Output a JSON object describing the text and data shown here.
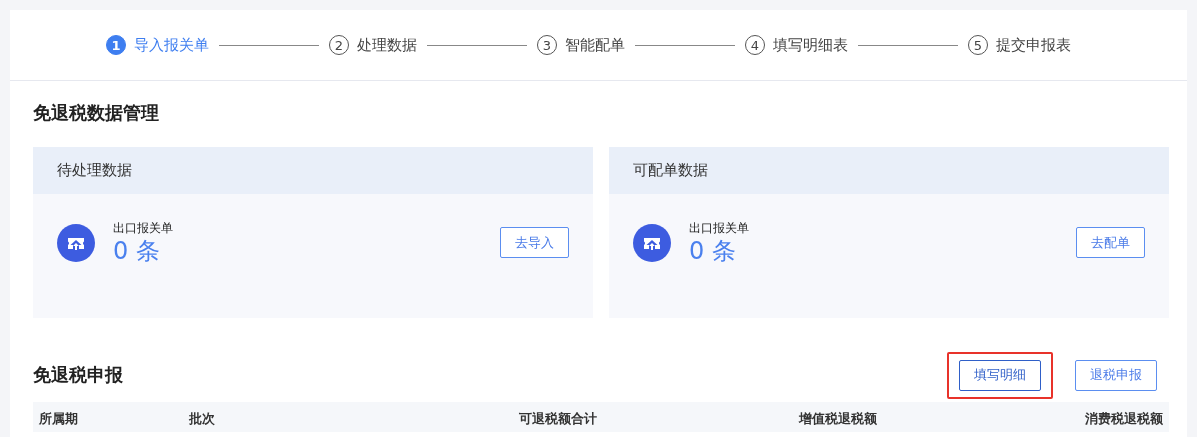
{
  "steps": [
    {
      "number": "1",
      "label": "导入报关单",
      "selected": true
    },
    {
      "number": "2",
      "label": "处理数据",
      "selected": false
    },
    {
      "number": "3",
      "label": "智能配单",
      "selected": false
    },
    {
      "number": "4",
      "label": "填写明细表",
      "selected": false
    },
    {
      "number": "5",
      "label": "提交申报表",
      "selected": false
    }
  ],
  "data_section": {
    "title": "免退税数据管理",
    "cards": [
      {
        "title": "待处理数据",
        "item_label": "出口报关单",
        "count": "0 条",
        "button": "去导入"
      },
      {
        "title": "可配单数据",
        "item_label": "出口报关单",
        "count": "0 条",
        "button": "去配单"
      }
    ]
  },
  "declaration_section": {
    "title": "免退税申报",
    "buttons": [
      {
        "label": "填写明细",
        "highlighted": true
      },
      {
        "label": "退税申报",
        "highlighted": false
      }
    ],
    "table": {
      "columns": [
        "所属期",
        "批次",
        "可退税额合计",
        "增值税退税额",
        "消费税退税额"
      ]
    }
  }
}
